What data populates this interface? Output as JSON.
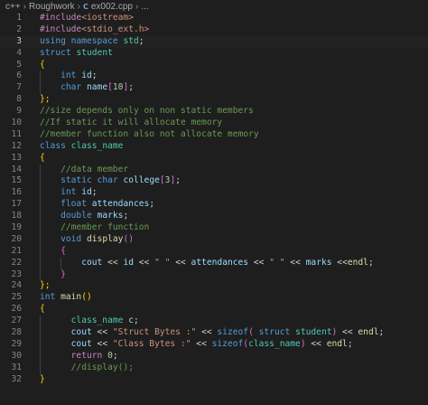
{
  "breadcrumb": {
    "items": [
      "c++",
      "Roughwork"
    ],
    "file_icon": "C",
    "file": "ex002.cpp",
    "trail": "..."
  },
  "editor": {
    "language": "cpp",
    "active_line": 3,
    "lines": [
      {
        "n": 1,
        "indent": 0,
        "tokens": [
          [
            "#include",
            "pp"
          ],
          [
            "<iostream>",
            "str"
          ]
        ]
      },
      {
        "n": 2,
        "indent": 0,
        "tokens": [
          [
            "#include",
            "pp"
          ],
          [
            "<stdio_ext.h>",
            "str"
          ]
        ]
      },
      {
        "n": 3,
        "indent": 0,
        "tokens": [
          [
            "using",
            "kw"
          ],
          [
            " ",
            "op"
          ],
          [
            "namespace",
            "kw"
          ],
          [
            " ",
            "op"
          ],
          [
            "std",
            "ty"
          ],
          [
            ";",
            "op"
          ]
        ]
      },
      {
        "n": 4,
        "indent": 0,
        "tokens": [
          [
            "struct",
            "kw"
          ],
          [
            " ",
            "op"
          ],
          [
            "student",
            "ty"
          ]
        ]
      },
      {
        "n": 5,
        "indent": 0,
        "tokens": [
          [
            "{",
            "b1"
          ]
        ]
      },
      {
        "n": 6,
        "indent": 1,
        "tokens": [
          [
            "int",
            "kw"
          ],
          [
            " ",
            "op"
          ],
          [
            "id",
            "id"
          ],
          [
            ";",
            "op"
          ]
        ]
      },
      {
        "n": 7,
        "indent": 1,
        "tokens": [
          [
            "char",
            "kw"
          ],
          [
            " ",
            "op"
          ],
          [
            "name",
            "id"
          ],
          [
            "[",
            "b2"
          ],
          [
            "10",
            "num"
          ],
          [
            "]",
            "b2"
          ],
          [
            ";",
            "op"
          ]
        ]
      },
      {
        "n": 8,
        "indent": 0,
        "tokens": [
          [
            "};",
            "b1"
          ]
        ]
      },
      {
        "n": 9,
        "indent": 0,
        "tokens": [
          [
            "//size depends only on non static members",
            "com"
          ]
        ]
      },
      {
        "n": 10,
        "indent": 0,
        "tokens": [
          [
            "//If static it will allocate memory",
            "com"
          ]
        ]
      },
      {
        "n": 11,
        "indent": 0,
        "tokens": [
          [
            "//member function also not allocate memory",
            "com"
          ]
        ]
      },
      {
        "n": 12,
        "indent": 0,
        "tokens": [
          [
            "class",
            "kw"
          ],
          [
            " ",
            "op"
          ],
          [
            "class_name",
            "ty"
          ]
        ]
      },
      {
        "n": 13,
        "indent": 0,
        "tokens": [
          [
            "{",
            "b1"
          ]
        ]
      },
      {
        "n": 14,
        "indent": 1,
        "tokens": [
          [
            "//data member",
            "com"
          ]
        ]
      },
      {
        "n": 15,
        "indent": 1,
        "tokens": [
          [
            "static",
            "kw"
          ],
          [
            " ",
            "op"
          ],
          [
            "char",
            "kw"
          ],
          [
            " ",
            "op"
          ],
          [
            "college",
            "id"
          ],
          [
            "[",
            "b2"
          ],
          [
            "3",
            "num"
          ],
          [
            "]",
            "b2"
          ],
          [
            ";",
            "op"
          ]
        ]
      },
      {
        "n": 16,
        "indent": 1,
        "tokens": [
          [
            "int",
            "kw"
          ],
          [
            " ",
            "op"
          ],
          [
            "id",
            "id"
          ],
          [
            ";",
            "op"
          ]
        ]
      },
      {
        "n": 17,
        "indent": 1,
        "tokens": [
          [
            "float",
            "kw"
          ],
          [
            " ",
            "op"
          ],
          [
            "attendances",
            "id"
          ],
          [
            ";",
            "op"
          ]
        ]
      },
      {
        "n": 18,
        "indent": 1,
        "tokens": [
          [
            "double",
            "kw"
          ],
          [
            " ",
            "op"
          ],
          [
            "marks",
            "id"
          ],
          [
            ";",
            "op"
          ]
        ]
      },
      {
        "n": 19,
        "indent": 1,
        "tokens": [
          [
            "//member function",
            "com"
          ]
        ]
      },
      {
        "n": 20,
        "indent": 1,
        "tokens": [
          [
            "void",
            "kw"
          ],
          [
            " ",
            "op"
          ],
          [
            "display",
            "fn"
          ],
          [
            "()",
            "b2"
          ]
        ]
      },
      {
        "n": 21,
        "indent": 1,
        "tokens": [
          [
            "{",
            "b2"
          ]
        ]
      },
      {
        "n": 22,
        "indent": 2,
        "tokens": [
          [
            "cout",
            "id"
          ],
          [
            " << ",
            "op"
          ],
          [
            "id",
            "id"
          ],
          [
            " << ",
            "op"
          ],
          [
            "\" \"",
            "str"
          ],
          [
            " << ",
            "op"
          ],
          [
            "attendances",
            "id"
          ],
          [
            " << ",
            "op"
          ],
          [
            "\" \"",
            "str"
          ],
          [
            " << ",
            "op"
          ],
          [
            "marks",
            "id"
          ],
          [
            " <<",
            "op"
          ],
          [
            "endl",
            "fn"
          ],
          [
            ";",
            "op"
          ]
        ]
      },
      {
        "n": 23,
        "indent": 1,
        "tokens": [
          [
            "}",
            "b2"
          ]
        ]
      },
      {
        "n": 24,
        "indent": 0,
        "tokens": [
          [
            "};",
            "b1"
          ]
        ]
      },
      {
        "n": 25,
        "indent": 0,
        "tokens": [
          [
            "int",
            "kw"
          ],
          [
            " ",
            "op"
          ],
          [
            "main",
            "fn"
          ],
          [
            "()",
            "b1"
          ]
        ]
      },
      {
        "n": 26,
        "indent": 0,
        "tokens": [
          [
            "{",
            "b1"
          ]
        ]
      },
      {
        "n": 27,
        "indent": 1,
        "pad": 2,
        "tokens": [
          [
            "class_name",
            "ty"
          ],
          [
            " ",
            "op"
          ],
          [
            "c",
            "id"
          ],
          [
            ";",
            "op"
          ]
        ]
      },
      {
        "n": 28,
        "indent": 1,
        "pad": 2,
        "tokens": [
          [
            "cout",
            "id"
          ],
          [
            " << ",
            "op"
          ],
          [
            "\"Struct Bytes :\"",
            "str"
          ],
          [
            " << ",
            "op"
          ],
          [
            "sizeof",
            "kw"
          ],
          [
            "(",
            "b2"
          ],
          [
            " ",
            "op"
          ],
          [
            "struct",
            "kw"
          ],
          [
            " ",
            "op"
          ],
          [
            "student",
            "ty"
          ],
          [
            ")",
            "b2"
          ],
          [
            " << ",
            "op"
          ],
          [
            "endl",
            "fn"
          ],
          [
            ";",
            "op"
          ]
        ]
      },
      {
        "n": 29,
        "indent": 1,
        "pad": 2,
        "tokens": [
          [
            "cout",
            "id"
          ],
          [
            " << ",
            "op"
          ],
          [
            "\"Class Bytes :\"",
            "str"
          ],
          [
            " << ",
            "op"
          ],
          [
            "sizeof",
            "kw"
          ],
          [
            "(",
            "b2"
          ],
          [
            "class_name",
            "ty"
          ],
          [
            ")",
            "b2"
          ],
          [
            " << ",
            "op"
          ],
          [
            "endl",
            "fn"
          ],
          [
            ";",
            "op"
          ]
        ]
      },
      {
        "n": 30,
        "indent": 1,
        "pad": 2,
        "tokens": [
          [
            "return",
            "cf"
          ],
          [
            " ",
            "op"
          ],
          [
            "0",
            "num"
          ],
          [
            ";",
            "op"
          ]
        ]
      },
      {
        "n": 31,
        "indent": 1,
        "pad": 2,
        "tokens": [
          [
            "//display();",
            "com"
          ]
        ]
      },
      {
        "n": 32,
        "indent": 0,
        "tokens": [
          [
            "}",
            "b1"
          ]
        ]
      }
    ]
  }
}
